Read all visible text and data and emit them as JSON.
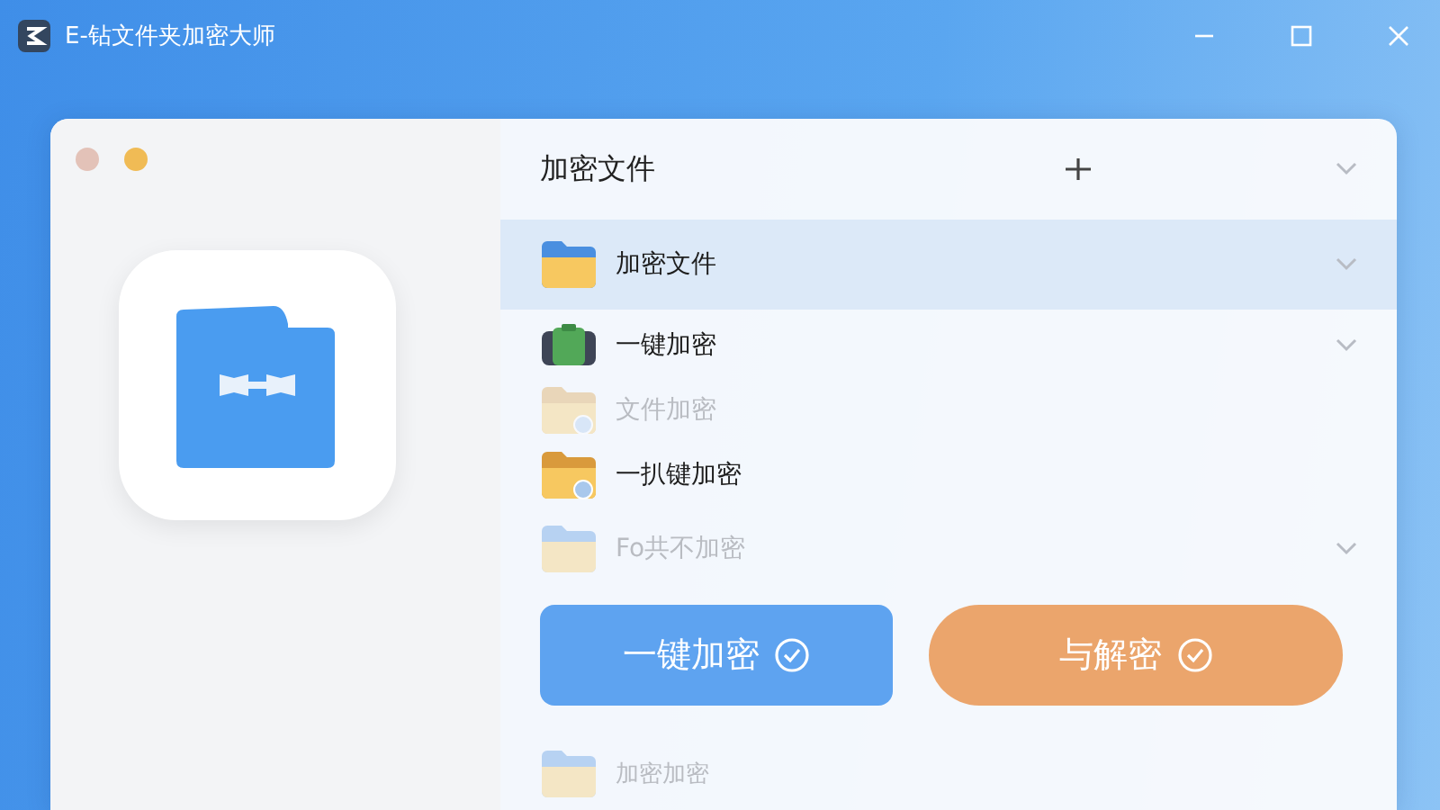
{
  "window": {
    "title": "E-钻文件夹加密大师"
  },
  "list": {
    "header": {
      "label": "加密文件"
    },
    "items": [
      {
        "label": "加密文件",
        "kind": "folder",
        "selected": true,
        "dimmed": false,
        "expandable": true
      },
      {
        "label": "一键加密",
        "kind": "case",
        "selected": false,
        "dimmed": false,
        "expandable": true
      },
      {
        "label": "文件加密",
        "kind": "lockfolder",
        "selected": false,
        "dimmed": true,
        "expandable": false
      },
      {
        "label": "一扒键加密",
        "kind": "lockfolder",
        "selected": false,
        "dimmed": false,
        "expandable": false
      },
      {
        "label": "Fo共不加密",
        "kind": "folder",
        "selected": false,
        "dimmed": true,
        "expandable": true
      }
    ]
  },
  "buttons": [
    {
      "label": "一键加密",
      "kind": "primary"
    },
    {
      "label": "与解密",
      "kind": "secondary"
    }
  ],
  "footer_item": {
    "label": "加密加密"
  }
}
